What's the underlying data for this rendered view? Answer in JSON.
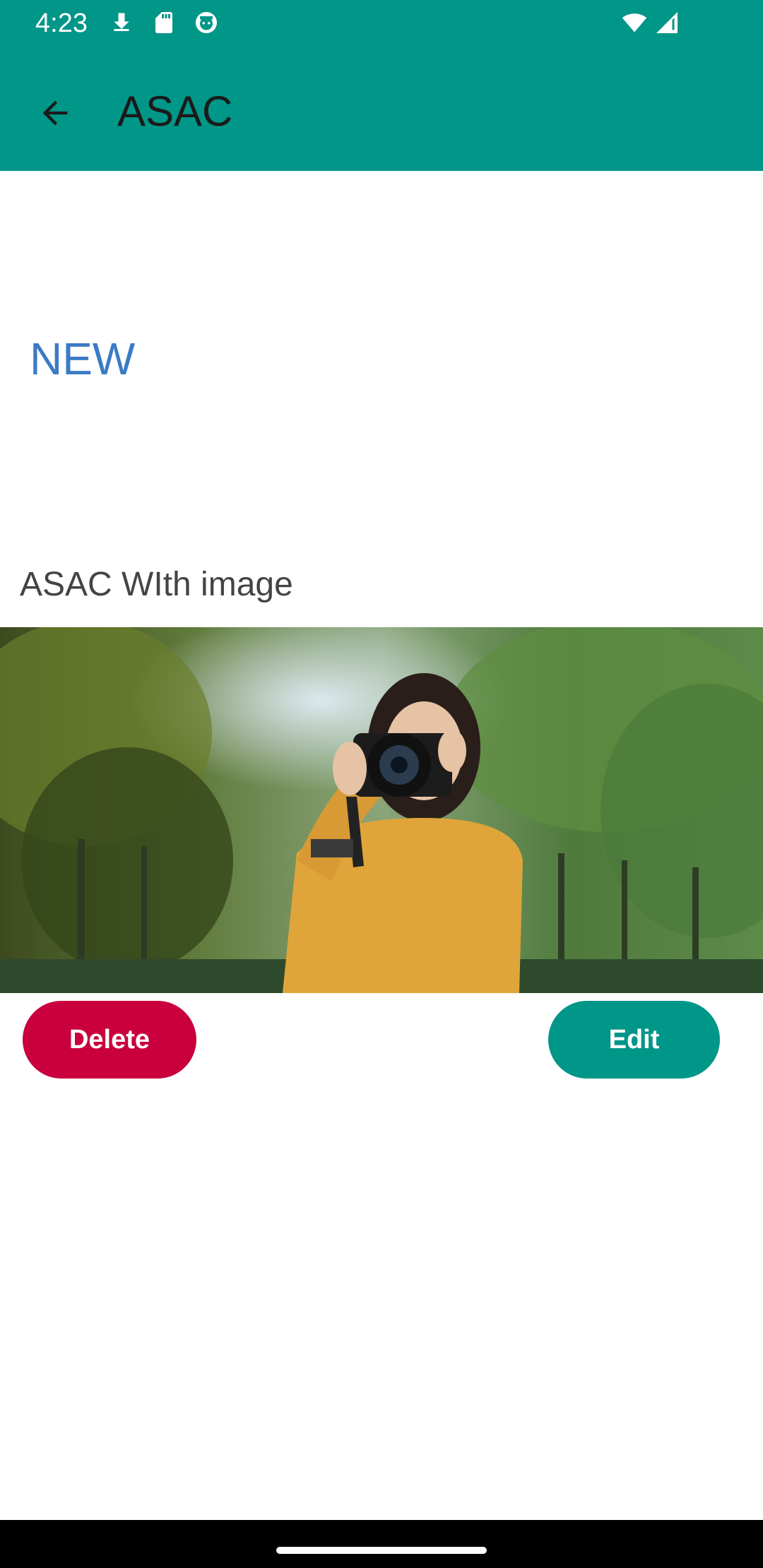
{
  "status_bar": {
    "time": "4:23",
    "left_icons": [
      "download-icon",
      "sd-card-icon",
      "android-robot-icon"
    ],
    "right_icons": [
      "wifi-icon",
      "cellular-signal-icon"
    ]
  },
  "app_bar": {
    "back_icon": "arrow-back-icon",
    "title": "ASAC"
  },
  "item": {
    "title": "NEW",
    "description": "ASAC WIth image",
    "image": "photo of a woman in an orange sweater holding a camera in front of trees"
  },
  "actions": {
    "delete_label": "Delete",
    "edit_label": "Edit"
  },
  "colors": {
    "primary": "#009688",
    "delete": "#c9003d",
    "title_text": "#3b7bc6",
    "background": "#fffbfe"
  }
}
